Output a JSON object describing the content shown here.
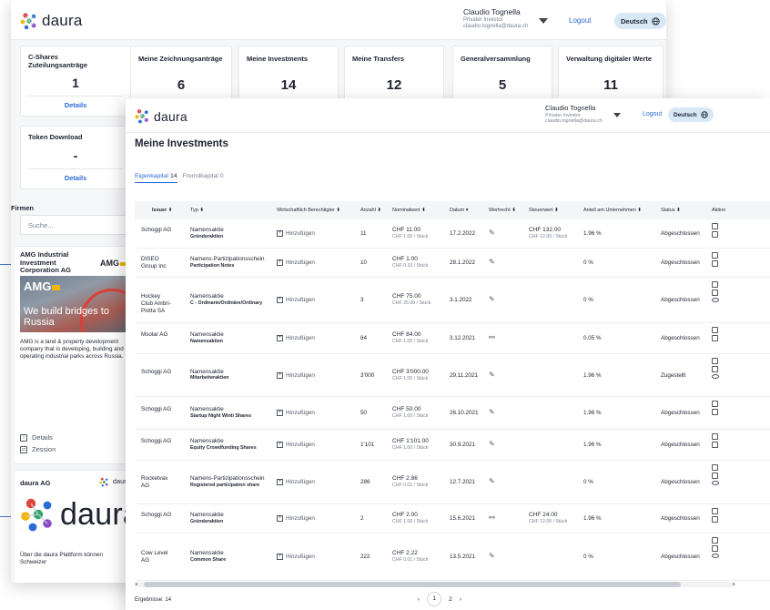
{
  "brand": {
    "name": "daura",
    "colors": {
      "accent": "#2b6bd6",
      "lang_bg": "#d9e8f7",
      "amg_yellow": "#f2b705"
    }
  },
  "user": {
    "name": "Claudio Tognella",
    "role": "Privater Investor",
    "email": "claudio.tognella@daura.ch"
  },
  "header": {
    "logout": "Logout",
    "language": "Deutsch",
    "language_icon": "globe-icon"
  },
  "dashboard": {
    "cshares": {
      "title": "C-Shares Zuteilungsanträge",
      "value": "1",
      "link": "Details"
    },
    "token": {
      "title": "Token Download",
      "value": "-",
      "link": "Details"
    },
    "stats": [
      {
        "title": "Meine Zeichnungsanträge",
        "value": "6"
      },
      {
        "title": "Meine Investments",
        "value": "14"
      },
      {
        "title": "Meine Transfers",
        "value": "12"
      },
      {
        "title": "Generalversammlung",
        "value": "5"
      },
      {
        "title": "Verwaltung digitaler Werte",
        "value": "11"
      }
    ],
    "firms_label": "Firmen",
    "search_placeholder": "Suche...",
    "amg": {
      "title": "AMG Industrial Investment Corporation AG",
      "logo_text": "AMG",
      "image_tagline": "We build bridges to Russia",
      "description": "AMG is a land & property development company that is developing, building and operating industrial parks across Russia.",
      "links": [
        "Details",
        "Zession"
      ]
    },
    "daura_card": {
      "title": "daura AG",
      "logo_text": "daura",
      "description": "Über die daura Plattform können Schweizer"
    }
  },
  "investments": {
    "title": "Meine Investments",
    "tabs": [
      {
        "label": "Eigenkapital",
        "count": "14"
      },
      {
        "label": "Fremdkapital",
        "count": "0"
      }
    ],
    "columns": [
      "Issuer",
      "Typ",
      "Wirtschaftlich Berechtigter",
      "Anzahl",
      "Nominalwert",
      "Datum",
      "Wertrecht",
      "Steuerwert",
      "Anteil am Unternehmen",
      "Status",
      "Aktion"
    ],
    "add_label": "Hinzufügen",
    "rows": [
      {
        "issuer": "Schoggi AG",
        "typ": "Namensaktie",
        "sub": "Gründeraktien",
        "anzahl": "11",
        "nominal": "CHF 11.00",
        "nominal_unit": "CHF 1.00 / Stück",
        "datum": "17.2.2022",
        "wertrecht": "pen",
        "steuer": "CHF 132.00",
        "steuer_unit": "CHF 12.00 / Stück",
        "anteil": "1.96 %",
        "status": "Abgeschlossen"
      },
      {
        "issuer": "DISEO Group Inc",
        "typ": "Namens-Partizipationsschein",
        "sub": "Participation Notes",
        "anzahl": "10",
        "nominal": "CHF 1.00",
        "nominal_unit": "CHF 0.10 / Stück",
        "datum": "28.1.2022",
        "wertrecht": "pen",
        "steuer": "",
        "steuer_unit": "",
        "anteil": "0 %",
        "status": "Abgeschlossen"
      },
      {
        "issuer": "Hockey Club Ambri-Piotta SA",
        "typ": "Namensaktie",
        "sub": "C - Ordinarie/Ordinäre/Ordinary",
        "anzahl": "3",
        "nominal": "CHF 75.00",
        "nominal_unit": "CHF 25.00 / Stück",
        "datum": "3.1.2022",
        "wertrecht": "pen",
        "steuer": "",
        "steuer_unit": "",
        "anteil": "0 %",
        "status": "Abgeschlossen"
      },
      {
        "issuer": "Msolar AG",
        "typ": "Namensaktie",
        "sub": "Namensaktien",
        "anzahl": "84",
        "nominal": "CHF 84.00",
        "nominal_unit": "CHF 1.00 / Stück",
        "datum": "3.12.2021",
        "wertrecht": "link",
        "steuer": "",
        "steuer_unit": "",
        "anteil": "0.05 %",
        "status": "Abgeschlossen"
      },
      {
        "issuer": "Schoggi AG",
        "typ": "Namensaktie",
        "sub": "Mitarbeiteraktien",
        "anzahl": "3'000",
        "nominal": "CHF 3'000.00",
        "nominal_unit": "CHF 1.00 / Stück",
        "datum": "29.11.2021",
        "wertrecht": "pen",
        "steuer": "",
        "steuer_unit": "",
        "anteil": "1.96 %",
        "status": "Zugestellt"
      },
      {
        "issuer": "Schoggi AG",
        "typ": "Namensaktie",
        "sub": "Startup Night Winti Shares",
        "anzahl": "50",
        "nominal": "CHF 50.00",
        "nominal_unit": "CHF 1.00 / Stück",
        "datum": "26.10.2021",
        "wertrecht": "pen",
        "steuer": "",
        "steuer_unit": "",
        "anteil": "1.96 %",
        "status": "Abgeschlossen"
      },
      {
        "issuer": "Schoggi AG",
        "typ": "Namensaktie",
        "sub": "Equity Crowdfunding Shares",
        "anzahl": "1'101",
        "nominal": "CHF 1'101.00",
        "nominal_unit": "CHF 1.00 / Stück",
        "datum": "30.9.2021",
        "wertrecht": "pen",
        "steuer": "",
        "steuer_unit": "",
        "anteil": "1.96 %",
        "status": "Abgeschlossen"
      },
      {
        "issuer": "Rocketvax AG",
        "typ": "Namens-Partizipationsschein",
        "sub": "Registered participation share",
        "anzahl": "286",
        "nominal": "CHF 2.86",
        "nominal_unit": "CHF 0.01 / Stück",
        "datum": "12.7.2021",
        "wertrecht": "pen",
        "steuer": "",
        "steuer_unit": "",
        "anteil": "0 %",
        "status": "Abgeschlossen"
      },
      {
        "issuer": "Schoggi AG",
        "typ": "Namensaktie",
        "sub": "Gründeraktien",
        "anzahl": "2",
        "nominal": "CHF 2.00",
        "nominal_unit": "CHF 1.00 / Stück",
        "datum": "15.6.2021",
        "wertrecht": "link",
        "steuer": "CHF 24.00",
        "steuer_unit": "CHF 12.00 / Stück",
        "anteil": "1.96 %",
        "status": "Abgeschlossen"
      },
      {
        "issuer": "Cow Level AG",
        "typ": "Namensaktie",
        "sub": "Common Share",
        "anzahl": "222",
        "nominal": "CHF 2.22",
        "nominal_unit": "CHF 0.01 / Stück",
        "datum": "13.5.2021",
        "wertrecht": "pen",
        "steuer": "",
        "steuer_unit": "",
        "anteil": "0 %",
        "status": "Abgeschlossen"
      }
    ],
    "footer": {
      "results": "Ergebnisse: 14",
      "pages": [
        "1",
        "2"
      ],
      "prev": "‹",
      "next": "›"
    }
  }
}
